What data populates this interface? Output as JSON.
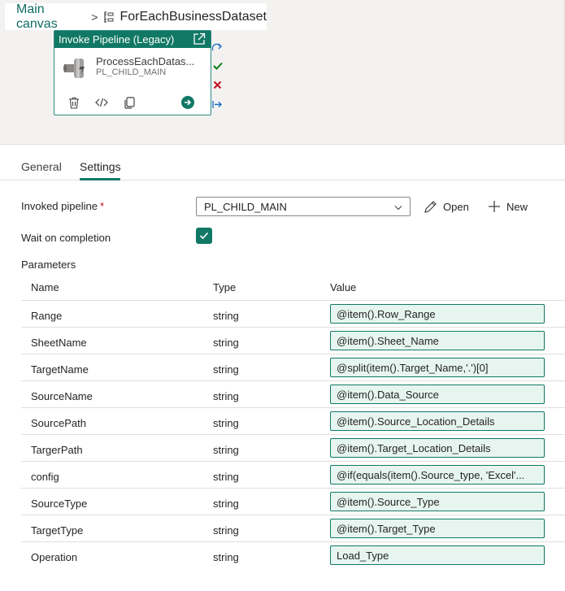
{
  "breadcrumb": {
    "root": "Main canvas",
    "separator": ">",
    "current": "ForEachBusinessDataset"
  },
  "activity": {
    "type": "Invoke Pipeline (Legacy)",
    "name": "ProcessEachDatas...",
    "pipeline": "PL_CHILD_MAIN"
  },
  "tabs": [
    {
      "label": "General"
    },
    {
      "label": "Settings"
    }
  ],
  "form": {
    "invoked_pipeline_label": "Invoked pipeline",
    "required_mark": "*",
    "invoked_pipeline_value": "PL_CHILD_MAIN",
    "open_label": "Open",
    "new_label": "New",
    "wait_label": "Wait on completion",
    "wait_checked": true,
    "parameters_label": "Parameters"
  },
  "parameters": {
    "headers": {
      "name": "Name",
      "type": "Type",
      "value": "Value"
    },
    "rows": [
      {
        "name": "Range",
        "type": "string",
        "value": "@item().Row_Range"
      },
      {
        "name": "SheetName",
        "type": "string",
        "value": "@item().Sheet_Name"
      },
      {
        "name": "TargetName",
        "type": "string",
        "value": "@split(item().Target_Name,'.')[0]"
      },
      {
        "name": "SourceName",
        "type": "string",
        "value": "@item().Data_Source"
      },
      {
        "name": "SourcePath",
        "type": "string",
        "value": "@item().Source_Location_Details"
      },
      {
        "name": "TargerPath",
        "type": "string",
        "value": "@item().Target_Location_Details"
      },
      {
        "name": "config",
        "type": "string",
        "value": "@if(equals(item().Source_type, 'Excel'..."
      },
      {
        "name": "SourceType",
        "type": "string",
        "value": "@item().Source_Type"
      },
      {
        "name": "TargetType",
        "type": "string",
        "value": "@item().Target_Type"
      },
      {
        "name": "Operation",
        "type": "string",
        "value": "Load_Type"
      }
    ]
  },
  "colors": {
    "accent": "#117865",
    "value_bg": "#e6f5ef",
    "required": "#c50f1f"
  }
}
